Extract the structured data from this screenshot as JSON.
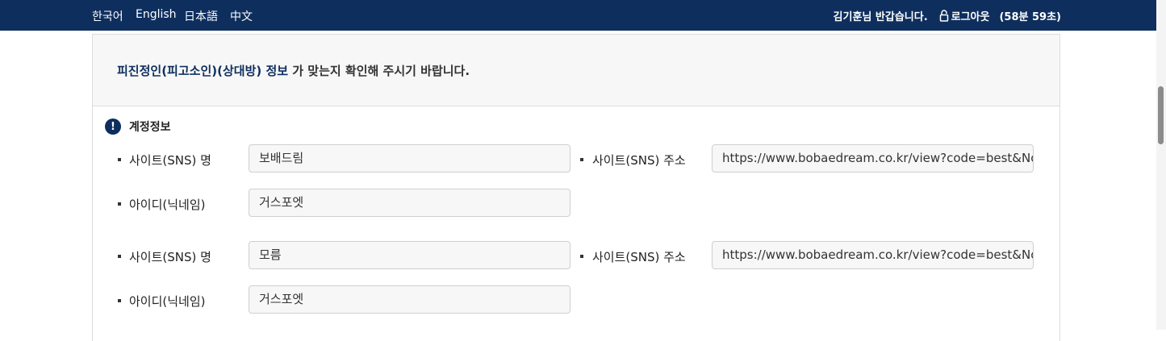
{
  "topbar": {
    "languages": [
      "한국어",
      "English",
      "日本語",
      "中文"
    ],
    "greeting": "김기훈님 반갑습니다.",
    "logout_label": "로그아웃",
    "session_timer": "(58분 59초)"
  },
  "panel": {
    "heading_strong": "피진정인(피고소인)(상대방) 정보",
    "heading_rest": " 가 맞는지 확인해 주시기 바랍니다.",
    "section_title": "계정정보",
    "alert_glyph": "!",
    "accounts": [
      {
        "site_name_label": "사이트(SNS) 명",
        "site_name_value": "보배드림",
        "site_url_label": "사이트(SNS) 주소",
        "site_url_value": "https://www.bobaedream.co.kr/view?code=best&No=",
        "nickname_label": "아이디(닉네임)",
        "nickname_value": "거스포엣"
      },
      {
        "site_name_label": "사이트(SNS) 명",
        "site_name_value": "모름",
        "site_url_label": "사이트(SNS) 주소",
        "site_url_value": "https://www.bobaedream.co.kr/view?code=best&No=",
        "nickname_label": "아이디(닉네임)",
        "nickname_value": "거스포엣"
      }
    ]
  },
  "colors": {
    "topbar_bg": "#0e2f5e",
    "accent": "#0e2f5e"
  }
}
